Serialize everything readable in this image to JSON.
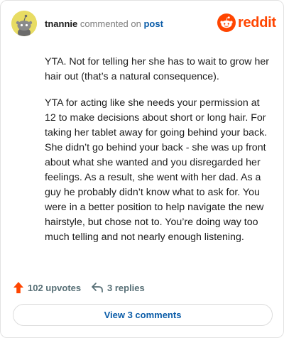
{
  "header": {
    "username": "tnannie",
    "action_text": "commented on",
    "post_link": "post",
    "brand": "reddit"
  },
  "comment": {
    "paragraphs": [
      "YTA. Not for telling her she has to wait to grow her hair out (that’s a natural consequence).",
      "YTA for acting like she needs your permission at 12 to make decisions about short or long hair. For taking her tablet away for going behind your back. She didn’t go behind your back - she was up front about what she wanted and you disregarded her feelings. As a result, she went with her dad. As a guy he probably didn’t know what to ask for. You were in a better position to help navigate the new hairstyle, but chose not to. You’re doing way too much telling and not nearly enough listening."
    ]
  },
  "actions": {
    "upvotes_label": "102 upvotes",
    "replies_label": "3 replies",
    "upvote_icon": "upvote-arrow-icon",
    "reply_icon": "reply-arrow-icon"
  },
  "footer": {
    "view_comments_label": "View 3 comments"
  },
  "colors": {
    "brand": "#ff4500",
    "link": "#0a5ca8",
    "muted": "#7c7c7c",
    "avatar_bg": "#e8dc63"
  }
}
